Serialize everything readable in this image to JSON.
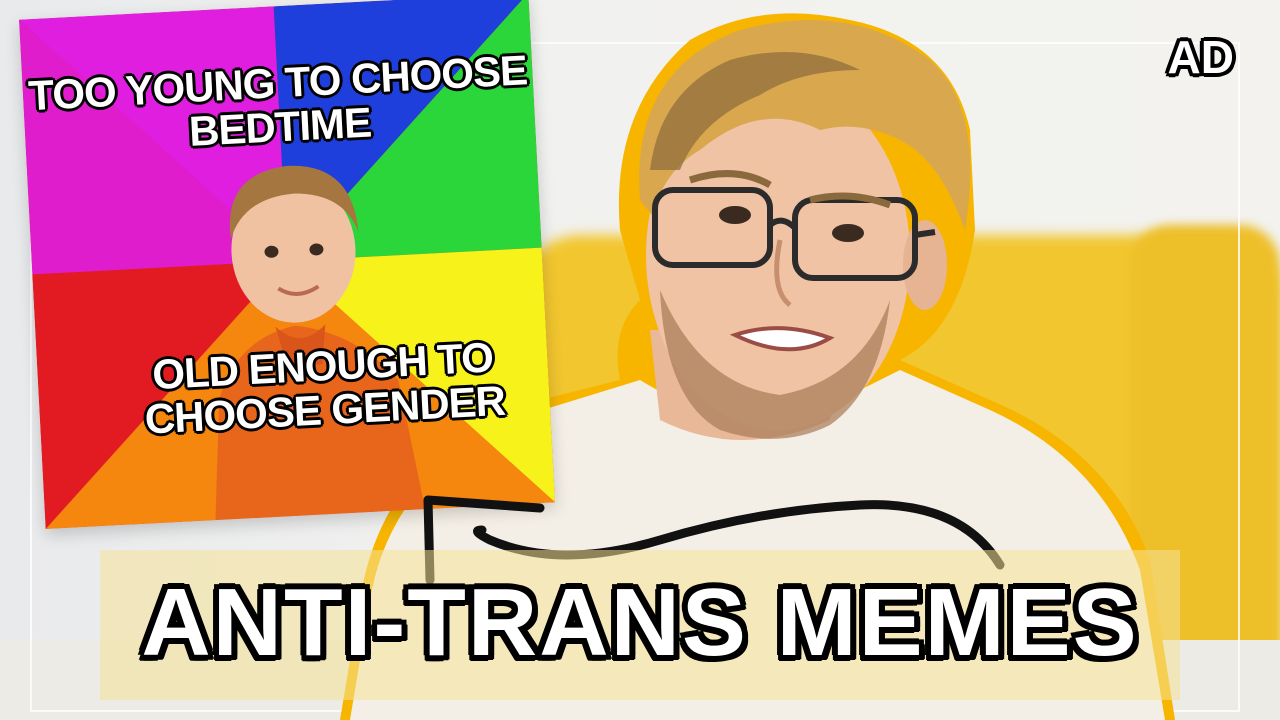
{
  "thumbnail": {
    "title": "ANTI-TRANS MEMES",
    "badge": "AD"
  },
  "meme": {
    "top_text": "TOO YOUNG TO CHOOSE BEDTIME",
    "bottom_text": "OLD ENOUGH TO CHOOSE GENDER",
    "watermark": "",
    "colors": {
      "magenta": "#e01ee0",
      "blue": "#1f3fdc",
      "green": "#2ad63a",
      "yellow": "#f7f21a",
      "orange": "#f5870f",
      "red": "#e21b22"
    }
  },
  "shirt_print": "",
  "colors": {
    "couch": "#f2c62f",
    "outline": "#f5b800",
    "banner": "#f6e196"
  }
}
